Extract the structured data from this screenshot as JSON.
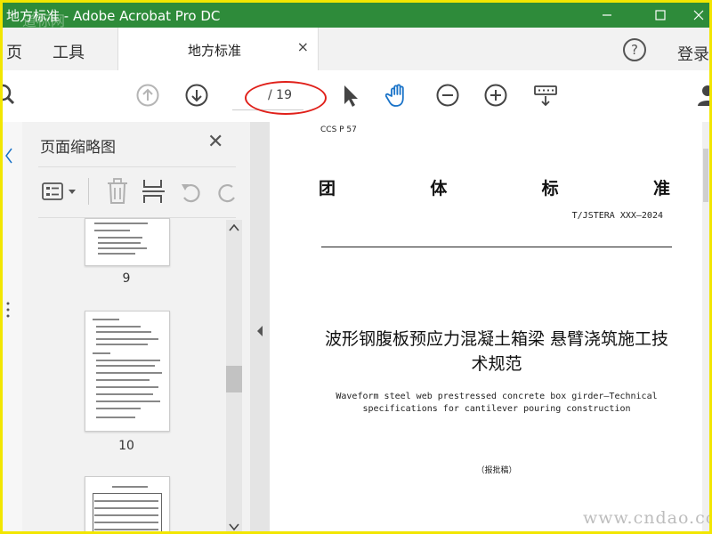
{
  "window": {
    "title": "地方标准 - Adobe Acrobat Pro DC",
    "watermark_top": "道标网",
    "watermark_bottom": "www.cndao.com"
  },
  "tabbar": {
    "home_label": "页",
    "tools_label": "工具",
    "doc_tab_label": "地方标准",
    "close_glyph": "×",
    "help_glyph": "?",
    "login_label": "登录"
  },
  "toolbar": {
    "page_total": "/ 19"
  },
  "thumbnail_panel": {
    "title": "页面缩略图",
    "close_glyph": "✕",
    "pages": [
      "9",
      "10"
    ]
  },
  "document": {
    "ccs_code": "CCS P 57",
    "title_chars": [
      "团",
      "体",
      "标",
      "准"
    ],
    "standard_no": "T/JSTERA XXX—2024",
    "cn_title_line1": "波形钢腹板预应力混凝土箱梁 悬臂浇筑施工技",
    "cn_title_line2": "术规范",
    "en_title_line1": "Waveform steel web prestressed concrete box girder—Technical",
    "en_title_line2": "specifications for cantilever pouring construction",
    "draft_label": "（报批稿）"
  },
  "colors": {
    "titlebar": "#2e8b3a",
    "frame_border": "#f2e600",
    "annotation_red": "#e0201a",
    "hand_tool_active": "#1a73c8"
  }
}
